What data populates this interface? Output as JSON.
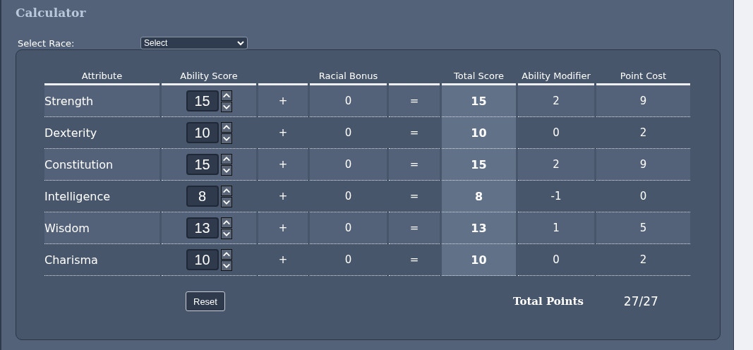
{
  "title": "Calculator",
  "race": {
    "label": "Select Race:",
    "value": "Select"
  },
  "table": {
    "columns": [
      "Attribute",
      "Ability Score",
      "",
      "Racial Bonus",
      "",
      "Total Score",
      "Ability Modifier",
      "Point Cost"
    ],
    "rows": [
      {
        "attribute": "Strength",
        "score": "15",
        "plus": "+",
        "bonus": "0",
        "equals": "=",
        "total": "15",
        "modifier": "2",
        "cost": "9"
      },
      {
        "attribute": "Dexterity",
        "score": "10",
        "plus": "+",
        "bonus": "0",
        "equals": "=",
        "total": "10",
        "modifier": "0",
        "cost": "2"
      },
      {
        "attribute": "Constitution",
        "score": "15",
        "plus": "+",
        "bonus": "0",
        "equals": "=",
        "total": "15",
        "modifier": "2",
        "cost": "9"
      },
      {
        "attribute": "Intelligence",
        "score": "8",
        "plus": "+",
        "bonus": "0",
        "equals": "=",
        "total": "8",
        "modifier": "-1",
        "cost": "0"
      },
      {
        "attribute": "Wisdom",
        "score": "13",
        "plus": "+",
        "bonus": "0",
        "equals": "=",
        "total": "13",
        "modifier": "1",
        "cost": "5"
      },
      {
        "attribute": "Charisma",
        "score": "10",
        "plus": "+",
        "bonus": "0",
        "equals": "=",
        "total": "10",
        "modifier": "0",
        "cost": "2"
      }
    ]
  },
  "reset": "Reset",
  "total_points": {
    "label": "Total Points",
    "value": "27/27"
  }
}
